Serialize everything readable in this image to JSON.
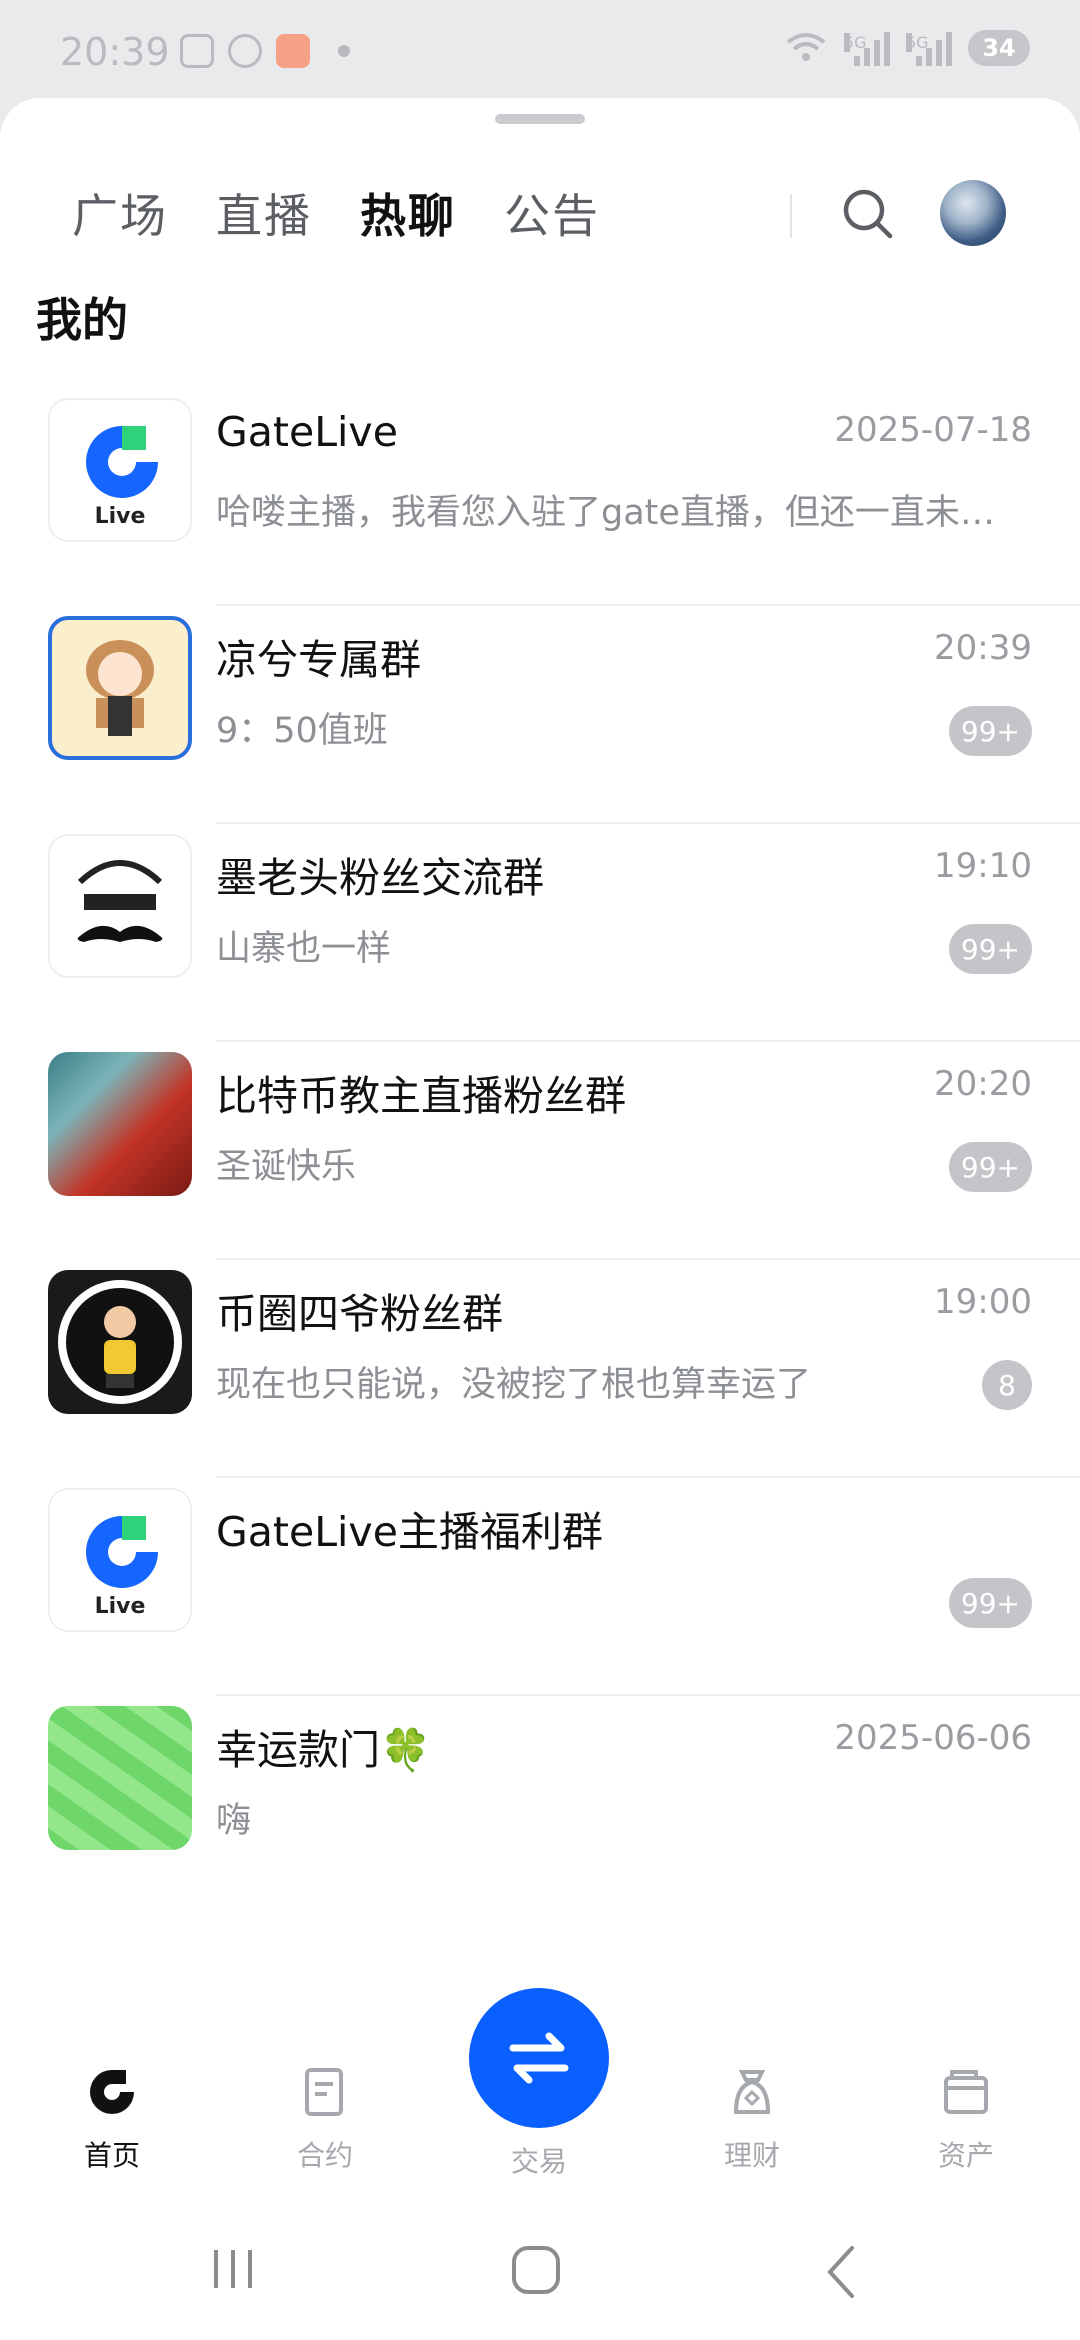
{
  "status_bar": {
    "time": "20:39",
    "signal_label_1": "5G",
    "signal_label_2": "5G",
    "battery": "34"
  },
  "header": {
    "tabs": [
      {
        "label": "广场",
        "active": false
      },
      {
        "label": "直播",
        "active": false
      },
      {
        "label": "热聊",
        "active": true
      },
      {
        "label": "公告",
        "active": false
      }
    ]
  },
  "section_title": "我的",
  "chats": [
    {
      "name": "GateLive",
      "time": "2025-07-18",
      "message": "哈喽主播，我看您入驻了gate直播，但还一直未…",
      "badge": "",
      "thumb_label": "Live"
    },
    {
      "name": "凉兮专属群",
      "time": "20:39",
      "message": "9：50值班",
      "badge": "99+"
    },
    {
      "name": "墨老头粉丝交流群",
      "time": "19:10",
      "message": "山寨也一样",
      "badge": "99+"
    },
    {
      "name": "比特币教主直播粉丝群",
      "time": "20:20",
      "message": "圣诞快乐",
      "badge": "99+"
    },
    {
      "name": "币圈四爷粉丝群",
      "time": "19:00",
      "message": "现在也只能说，没被挖了根也算幸运了",
      "badge": "8"
    },
    {
      "name": "GateLive主播福利群",
      "time": "",
      "message": "",
      "badge": "99+",
      "thumb_label": "Live"
    },
    {
      "name": "幸运款门🍀",
      "time": "2025-06-06",
      "message": "嗨",
      "badge": ""
    }
  ],
  "bottom_nav": {
    "items": [
      {
        "label": "首页",
        "icon": "home-icon",
        "active": true
      },
      {
        "label": "合约",
        "icon": "contract-icon",
        "active": false
      },
      {
        "label": "交易",
        "icon": "trade-icon",
        "active": false
      },
      {
        "label": "理财",
        "icon": "finance-icon",
        "active": false
      },
      {
        "label": "资产",
        "icon": "assets-icon",
        "active": false
      }
    ]
  },
  "colors": {
    "accent": "#0a60ff",
    "badge": "#c3c5c9"
  }
}
